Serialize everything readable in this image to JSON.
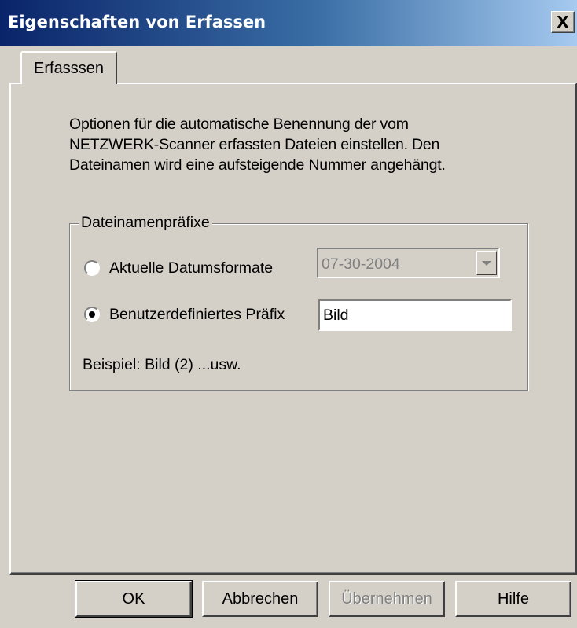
{
  "window": {
    "title": "Eigenschaften von Erfassen",
    "close_symbol": "X",
    "close_icon": "close-icon"
  },
  "tabs": [
    {
      "label": "Erfasssen",
      "selected": true
    }
  ],
  "description": {
    "line1": "Optionen für die automatische Benennung der vom",
    "line2": "NETZWERK-Scanner erfassten Dateien einstellen. Den",
    "line3": "Dateinamen wird eine aufsteigende Nummer angehängt."
  },
  "group": {
    "title": "Dateinamenpräfixe",
    "option_date": {
      "label": "Aktuelle Datumsformate",
      "selected": false
    },
    "date_select": {
      "value": "07-30-2004",
      "disabled": true
    },
    "option_custom": {
      "label": "Benutzerdefiniertes Präfix",
      "selected": true
    },
    "prefix_input": {
      "value": "Bild"
    },
    "example": "Beispiel: Bild (2) ...usw."
  },
  "buttons": {
    "ok": "OK",
    "cancel": "Abbrechen",
    "apply": "Übernehmen",
    "help": "Hilfe"
  },
  "colors": {
    "title_bar_start": "#0a246a",
    "title_bar_end": "#a6caf0",
    "dialog_face": "#d4d0c8"
  }
}
